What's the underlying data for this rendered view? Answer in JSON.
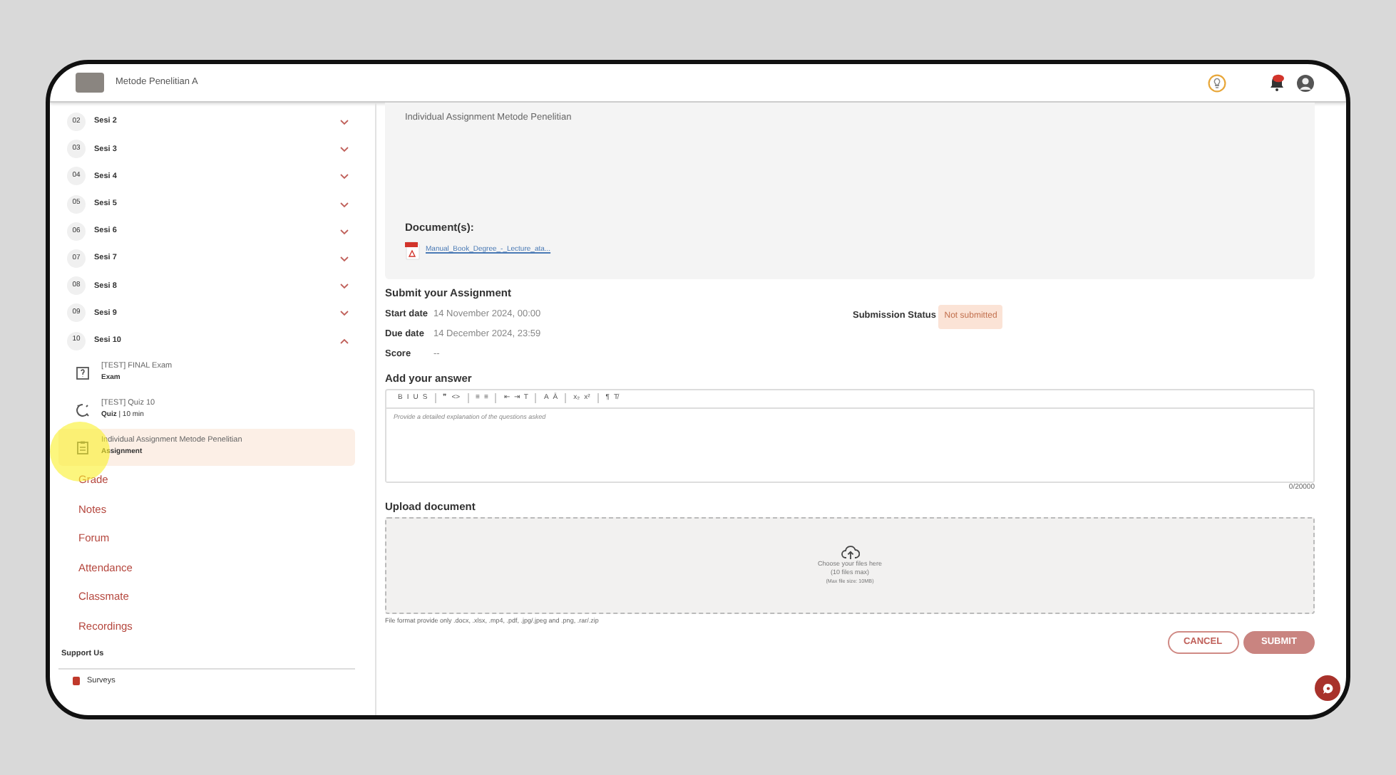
{
  "header": {
    "course_title": "Metode Penelitian A"
  },
  "sidebar": {
    "sessions": [
      {
        "number": "02",
        "title": "Sesi 2",
        "expanded": false
      },
      {
        "number": "03",
        "title": "Sesi 3",
        "expanded": false
      },
      {
        "number": "04",
        "title": "Sesi 4",
        "expanded": false
      },
      {
        "number": "05",
        "title": "Sesi 5",
        "expanded": false
      },
      {
        "number": "06",
        "title": "Sesi 6",
        "expanded": false
      },
      {
        "number": "07",
        "title": "Sesi 7",
        "expanded": false
      },
      {
        "number": "08",
        "title": "Sesi 8",
        "expanded": false
      },
      {
        "number": "09",
        "title": "Sesi 9",
        "expanded": false
      },
      {
        "number": "10",
        "title": "Sesi 10",
        "expanded": true,
        "children": [
          {
            "kind": "exam",
            "title": "[TEST] FINAL Exam",
            "subtitle": "Exam",
            "selected": false
          },
          {
            "kind": "quiz",
            "title": "[TEST] Quiz 10",
            "subtitle": "**Quiz** | 10 min",
            "selected": false
          },
          {
            "kind": "assignment",
            "title": "Individual Assignment Metode Penelitian",
            "subtitle": "Assignment",
            "selected": true
          }
        ]
      }
    ],
    "links": [
      "Grade",
      "Notes",
      "Forum",
      "Attendance",
      "Classmate",
      "Recordings"
    ],
    "support": {
      "heading": "Support Us",
      "items": [
        "Surveys"
      ]
    }
  },
  "main": {
    "description": "Individual Assignment Metode Penelitian",
    "documents_heading": "Document(s):",
    "documents": [
      {
        "name": "Manual_Book_Degree_-_Lecture_ata..."
      }
    ],
    "submit_heading": "Submit your Assignment",
    "details": [
      {
        "label": "Start date",
        "value": "14 November 2024, 00:00"
      },
      {
        "label": "Due date",
        "value": "14 December 2024, 23:59"
      },
      {
        "label": "Score",
        "value": "--"
      }
    ],
    "status_label": "Submission Status",
    "status": "Not submitted",
    "answer": {
      "heading": "Add your answer",
      "toolbar": [
        [
          "B",
          "I",
          "U",
          "S"
        ],
        [
          "❞",
          "<>"
        ],
        [
          "≡",
          "≡"
        ],
        [
          "⇤",
          "⇥",
          "T"
        ],
        [
          "A",
          "Ā"
        ],
        [
          "x₂",
          "x²"
        ],
        [
          "¶",
          "T̸"
        ]
      ],
      "placeholder": "Provide a detailed explanation of the questions asked",
      "counter": "0/20000"
    },
    "upload": {
      "heading": "Upload document",
      "lines": [
        "Choose your files here",
        "(10 files max)"
      ],
      "size_note": "(Max file size: 10MB)",
      "formats": "File format provide only .docx, .xlsx, .mp4, .pdf, .jpg/.jpeg and .png, .rar/.zip"
    },
    "buttons": {
      "cancel": "CANCEL",
      "submit": "SUBMIT"
    }
  }
}
